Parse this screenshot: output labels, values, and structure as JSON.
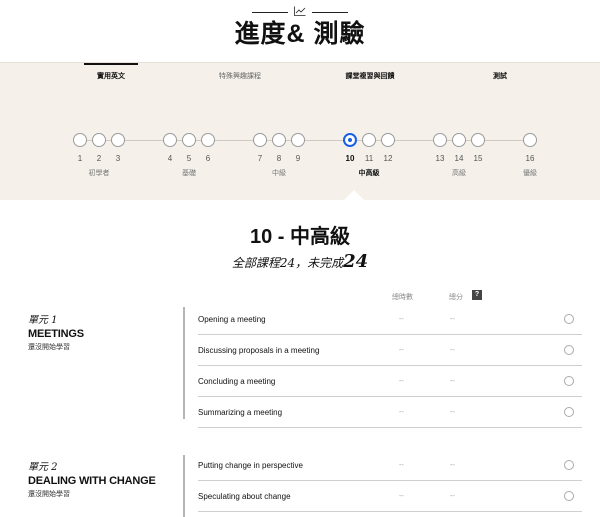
{
  "header": {
    "title": "進度& 測驗",
    "icon": "line-chart-icon"
  },
  "tabs": [
    {
      "label": "實用英文",
      "active": true
    },
    {
      "label": "特殊興趣課程",
      "active": false
    },
    {
      "label": "課堂複習與回饋",
      "active": false
    },
    {
      "label": "測試",
      "active": false
    }
  ],
  "progress": {
    "current_step": "10",
    "steps": [
      "1",
      "2",
      "3",
      "4",
      "5",
      "6",
      "7",
      "8",
      "9",
      "10",
      "11",
      "12",
      "13",
      "14",
      "15",
      "16"
    ],
    "levels": [
      "初學者",
      "基礎",
      "中級",
      "中高級",
      "高級",
      "優級"
    ],
    "accent_color": "#1b5fe6"
  },
  "level": {
    "heading": "10 - 中高級",
    "summary_prefix": "全部課程24，未完成",
    "summary_count": "24"
  },
  "columns": {
    "hours": "總時數",
    "score": "總分",
    "help": "?"
  },
  "units": [
    {
      "kicker": "單元 1",
      "title": "MEETINGS",
      "status": "還沒開始學習",
      "lessons": [
        {
          "name": "Opening a meeting",
          "hours": "--",
          "score": "--"
        },
        {
          "name": "Discussing proposals in a meeting",
          "hours": "--",
          "score": "--"
        },
        {
          "name": "Concluding a meeting",
          "hours": "--",
          "score": "--"
        },
        {
          "name": "Summarizing a meeting",
          "hours": "--",
          "score": "--"
        }
      ]
    },
    {
      "kicker": "單元 2",
      "title": "DEALING WITH CHANGE",
      "status": "還沒開始學習",
      "lessons": [
        {
          "name": "Putting change in perspective",
          "hours": "--",
          "score": "--"
        },
        {
          "name": "Speculating about change",
          "hours": "--",
          "score": "--"
        }
      ]
    }
  ]
}
